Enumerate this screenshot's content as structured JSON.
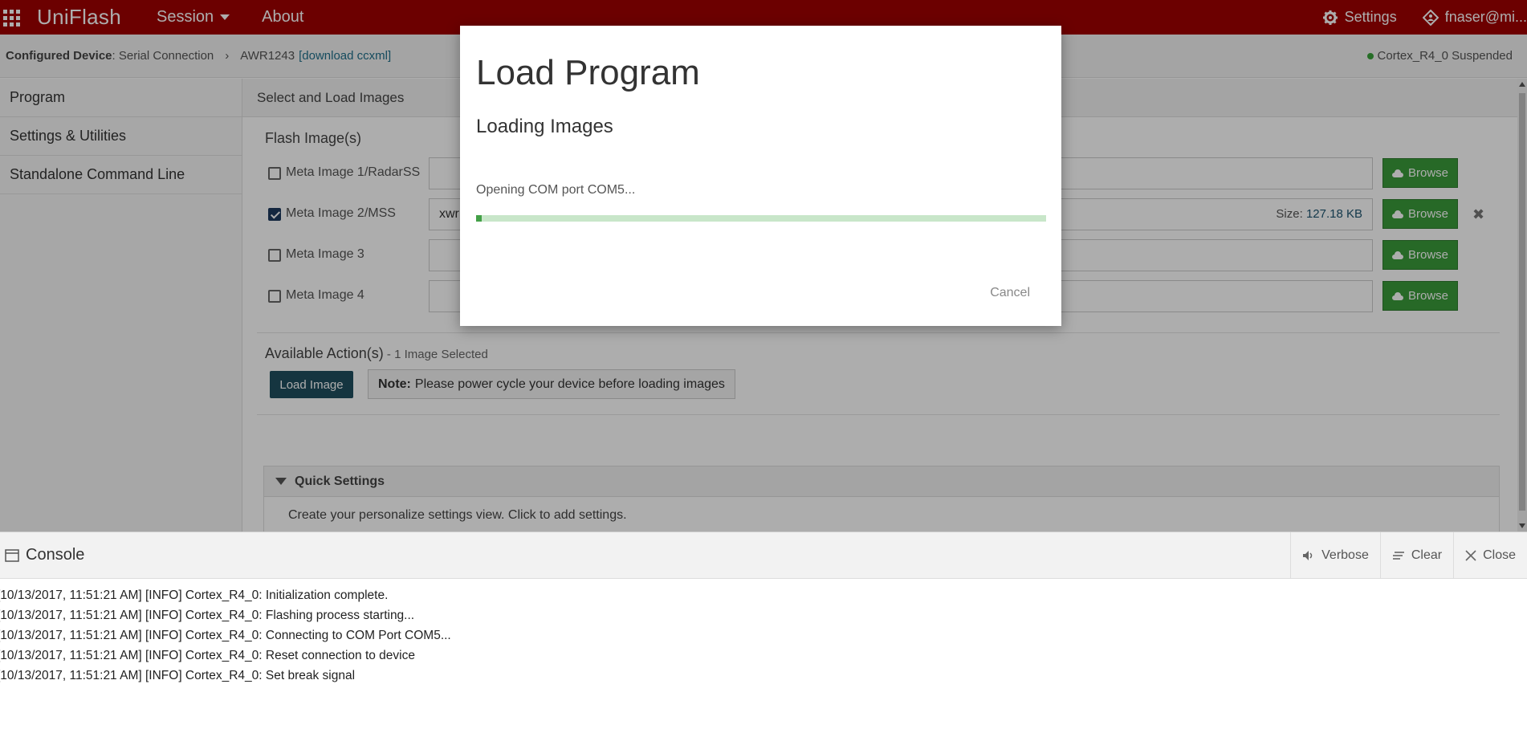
{
  "topbar": {
    "brand": "UniFlash",
    "nav": [
      {
        "label": "Session",
        "has_dropdown": true
      },
      {
        "label": "About",
        "has_dropdown": false
      }
    ],
    "settings_label": "Settings",
    "user_label": "fnaser@mi...",
    "icons": {
      "apps": "apps-grid-icon",
      "settings": "gear-icon",
      "user": "user-diamond-icon"
    }
  },
  "breadcrumb": {
    "configured_label": "Configured Device",
    "connection": ": Serial Connection",
    "device": "AWR1243",
    "link": "[download ccxml]",
    "status": "Cortex_R4_0 Suspended"
  },
  "sidebar": {
    "items": [
      {
        "label": "Program"
      },
      {
        "label": "Settings & Utilities"
      },
      {
        "label": "Standalone Command Line"
      }
    ]
  },
  "main": {
    "header": "Select and Load Images",
    "flash_title": "Flash Image(s)",
    "images": [
      {
        "label": "Meta Image 1/RadarSS",
        "checked": false,
        "value": "",
        "size_label": "",
        "size": "",
        "browse": "Browse",
        "removable": false
      },
      {
        "label": "Meta Image 2/MSS",
        "checked": true,
        "value": "xwr",
        "size_label": "Size:",
        "size": "127.18 KB",
        "browse": "Browse",
        "removable": true
      },
      {
        "label": "Meta Image 3",
        "checked": false,
        "value": "",
        "size_label": "",
        "size": "",
        "browse": "Browse",
        "removable": false
      },
      {
        "label": "Meta Image 4",
        "checked": false,
        "value": "",
        "size_label": "",
        "size": "",
        "browse": "Browse",
        "removable": false
      }
    ],
    "actions_title": "Available Action(s)",
    "actions_sub": " - 1 Image Selected",
    "load_button": "Load Image",
    "note_bold": "Note:",
    "note_text": "Please power cycle your device before loading images",
    "quick_settings_title": "Quick Settings",
    "quick_settings_body": "Create your personalize settings view. Click to add settings."
  },
  "dialog": {
    "title": "Load Program",
    "subtitle": "Loading Images",
    "message": "Opening COM port COM5...",
    "progress": 0.01,
    "cancel_label": "Cancel"
  },
  "console": {
    "title": "Console",
    "tools": [
      {
        "label": "Verbose",
        "icon": "speaker-icon"
      },
      {
        "label": "Clear",
        "icon": "clear-lines-icon"
      },
      {
        "label": "Close",
        "icon": "close-icon"
      }
    ],
    "lines": [
      "[10/13/2017, 11:51:21 AM] [INFO] Cortex_R4_0: Initialization complete.",
      "[10/13/2017, 11:51:21 AM] [INFO] Cortex_R4_0: Flashing process starting...",
      "[10/13/2017, 11:51:21 AM] [INFO] Cortex_R4_0: Connecting to COM Port COM5...",
      "[10/13/2017, 11:51:21 AM] [INFO] Cortex_R4_0: Reset connection to device",
      "[10/13/2017, 11:51:21 AM] [INFO] Cortex_R4_0: Set break signal"
    ]
  },
  "colors": {
    "topbar": "#a00000",
    "browse": "#3a9b3a",
    "load_button": "#1f4e5f",
    "progress_track": "#c8e6c9",
    "progress_fill": "#43a047",
    "status_dot": "#38a33a"
  }
}
